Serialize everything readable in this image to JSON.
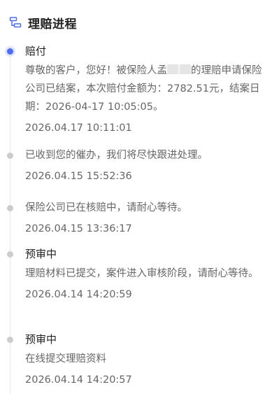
{
  "header": {
    "title": "理赔进程",
    "icon": "process-flow-icon"
  },
  "timeline": [
    {
      "title": "赔付",
      "desc_before_mask": "尊敬的客户，您好！被保险人孟",
      "desc_after_mask": "的理赔申请保险公司已结案，本次赔付金额为：2782.51元，结案日期：2026-04-17 10:05:05。",
      "time": "2026.04.17 10:11:01",
      "active": true
    },
    {
      "title": "",
      "desc": "已收到您的催办，我们将尽快跟进处理。",
      "time": "2026.04.15 15:52:36",
      "active": false
    },
    {
      "title": "",
      "desc": "保险公司已在核赔中，请耐心等待。",
      "time": "2026.04.15 13:36:17",
      "active": false
    },
    {
      "title": "预审中",
      "desc": "理赔材料已提交，案件进入审核阶段，请耐心等待。",
      "time": "2026.04.14 14:20:59",
      "active": false
    },
    {
      "title": "预审中",
      "desc": "在线提交理赔资料",
      "time": "2026.04.14 14:20:57",
      "active": false
    }
  ],
  "colors": {
    "active_dot": "#4a6cf7",
    "inactive_dot": "#cccccc",
    "line": "#e6e6e6"
  }
}
